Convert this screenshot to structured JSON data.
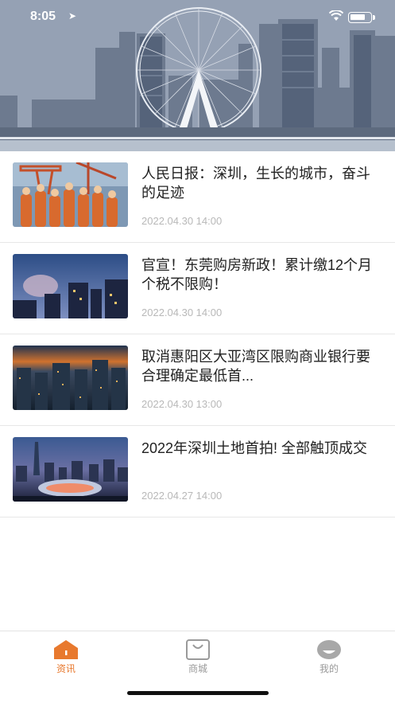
{
  "status": {
    "time": "8:05",
    "location_icon": "location-arrow-icon",
    "wifi_icon": "wifi-icon",
    "battery_icon": "battery-icon"
  },
  "banner": {
    "image": "city-skyline-ferris-wheel"
  },
  "news": [
    {
      "title": "人民日报：深圳，生长的城市，奋斗的足迹",
      "date": "2022.04.30 14:00",
      "thumb": "workers-photo"
    },
    {
      "title": "官宣！东莞购房新政！累计缴12个月个税不限购！",
      "date": "2022.04.30 14:00",
      "thumb": "city-dusk-photo"
    },
    {
      "title": "取消惠阳区大亚湾区限购商业银行要合理确定最低首...",
      "date": "2022.04.30 13:00",
      "thumb": "city-night-photo"
    },
    {
      "title": "2022年深圳土地首拍! 全部触顶成交",
      "date": "2022.04.27 14:00",
      "thumb": "stadium-night-photo"
    }
  ],
  "tabbar": {
    "items": [
      {
        "label": "资讯",
        "icon": "news-house-icon",
        "active": true
      },
      {
        "label": "商城",
        "icon": "shopping-bag-icon",
        "active": false
      },
      {
        "label": "我的",
        "icon": "profile-icon",
        "active": false
      }
    ],
    "active_color": "#e8792e",
    "inactive_color": "#9a9a9a"
  }
}
